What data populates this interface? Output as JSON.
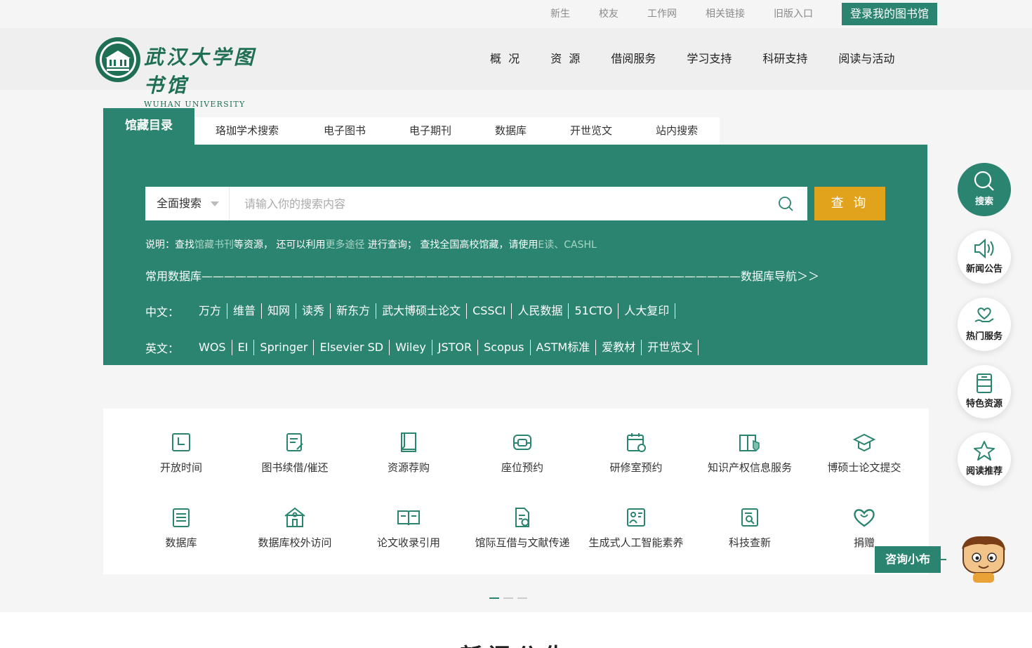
{
  "top_links": [
    "新生",
    "校友",
    "工作网",
    "相关链接",
    "旧版入口"
  ],
  "top_login": "登录我的图书馆",
  "logo": {
    "cn": "武汉大学图书馆",
    "en": "WUHAN UNIVERSITY LIBRARY"
  },
  "nav": [
    "概  况",
    "资  源",
    "借阅服务",
    "学习支持",
    "科研支持",
    "阅读与活动"
  ],
  "search_tabs": {
    "active": "馆藏目录",
    "items": [
      "珞珈学术搜索",
      "电子图书",
      "电子期刊",
      "数据库",
      "开世览文",
      "站内搜索"
    ]
  },
  "search": {
    "scope": "全面搜索",
    "placeholder": "请输入你的搜索内容",
    "button": "查 询",
    "hint": {
      "t1": "说明：查找",
      "l1": "馆藏书刊",
      "t2": "等资源， 还可以利用",
      "l2": "更多途径",
      "t3": " 进行查询； 查找全国高校馆藏，请使用",
      "l3": "E读",
      "t4": "、",
      "l4": "CASHL"
    }
  },
  "databases": {
    "title": "常用数据库————————————————————————————————————————————————数据库导航＞＞",
    "cn_label": "中文：",
    "cn": [
      "万方",
      "维普",
      "知网",
      "读秀",
      "新东方",
      "武大博硕士论文",
      "CSSCI",
      "人民数据",
      "51CTO",
      "人大复印"
    ],
    "en_label": "英文：",
    "en": [
      "WOS",
      "EI",
      "Springer",
      "Elsevier SD",
      "Wiley",
      "JSTOR",
      "Scopus",
      "ASTM标准",
      "爱教材",
      "开世览文"
    ]
  },
  "services": [
    {
      "label": "开放时间",
      "icon": "clock-icon"
    },
    {
      "label": "图书续借/催还",
      "icon": "renew-icon"
    },
    {
      "label": "资源荐购",
      "icon": "book-icon"
    },
    {
      "label": "座位预约",
      "icon": "seat-icon"
    },
    {
      "label": "研修室预约",
      "icon": "calendar-icon"
    },
    {
      "label": "知识产权信息服务",
      "icon": "ip-icon"
    },
    {
      "label": "博硕士论文提交",
      "icon": "graduation-icon"
    },
    {
      "label": "数据库",
      "icon": "database-icon"
    },
    {
      "label": "数据库校外访问",
      "icon": "house-icon"
    },
    {
      "label": "论文收录引用",
      "icon": "open-book-icon"
    },
    {
      "label": "馆际互借与文献传递",
      "icon": "document-icon"
    },
    {
      "label": "生成式人工智能素养",
      "icon": "ai-icon"
    },
    {
      "label": "科技查新",
      "icon": "search-doc-icon"
    },
    {
      "label": "捐赠",
      "icon": "heart-icon"
    }
  ],
  "news_title": "新闻公告",
  "floating": [
    "搜索",
    "新闻公告",
    "热门服务",
    "特色资源",
    "阅读推荐"
  ],
  "chat": "咨询小布",
  "colors": {
    "primary": "#2a8470",
    "accent": "#e1a31c"
  }
}
